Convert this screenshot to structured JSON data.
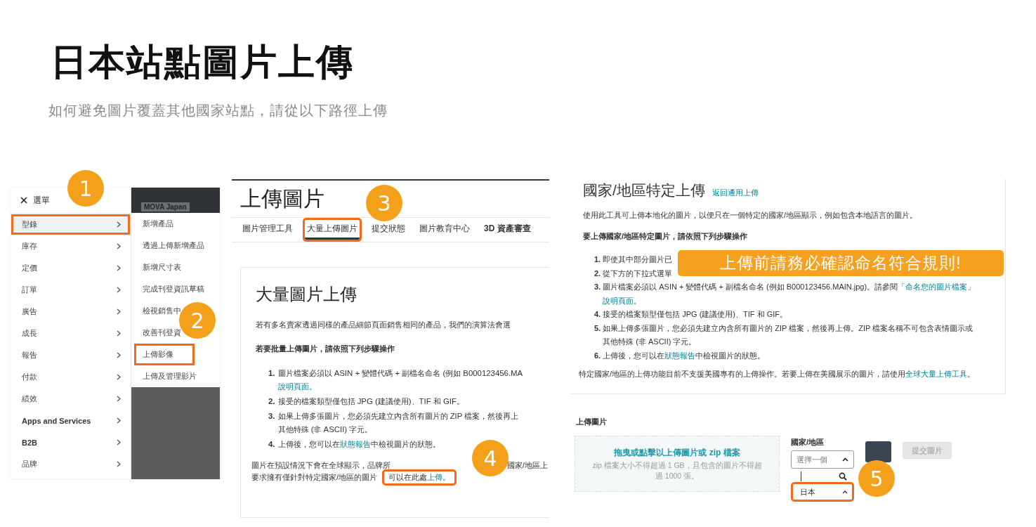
{
  "slide": {
    "title": "日本站點圖片上傳",
    "subtitle": "如何避免圖片覆蓋其他國家站點，請從以下路徑上傳"
  },
  "menu_panel": {
    "header": "選單",
    "backdrop_text": "MOVA Japan",
    "items": [
      {
        "label": "型錄",
        "selected": true,
        "highlighted": true
      },
      {
        "label": "庫存",
        "selected": false,
        "highlighted": false
      },
      {
        "label": "定價",
        "selected": false,
        "highlighted": false
      },
      {
        "label": "訂單",
        "selected": false,
        "highlighted": false
      },
      {
        "label": "廣告",
        "selected": false,
        "highlighted": false
      },
      {
        "label": "成長",
        "selected": false,
        "highlighted": false
      },
      {
        "label": "報告",
        "selected": false,
        "highlighted": false
      },
      {
        "label": "付款",
        "selected": false,
        "highlighted": false
      },
      {
        "label": "績效",
        "selected": false,
        "highlighted": false
      },
      {
        "label": "Apps and Services",
        "selected": false,
        "highlighted": false
      },
      {
        "label": "B2B",
        "selected": false,
        "highlighted": false
      },
      {
        "label": "品牌",
        "selected": false,
        "highlighted": false
      }
    ],
    "submenu": [
      {
        "label": "新增產品",
        "highlighted": false
      },
      {
        "label": "透過上傳新增產品",
        "highlighted": false
      },
      {
        "label": "新增尺寸表",
        "highlighted": false
      },
      {
        "label": "完成刊登資訊草稿",
        "highlighted": false
      },
      {
        "label": "檢視銷售中",
        "highlighted": false
      },
      {
        "label": "改善刊登資",
        "highlighted": false
      },
      {
        "label": "上傳影像",
        "highlighted": true
      },
      {
        "label": "上傳及管理影片",
        "highlighted": false
      }
    ]
  },
  "bulk_panel": {
    "title": "上傳圖片",
    "tabs": [
      {
        "label": "圖片管理工具",
        "selected": false,
        "highlighted": false
      },
      {
        "label": "大量上傳圖片",
        "selected": true,
        "highlighted": true
      },
      {
        "label": "提交狀態",
        "selected": false,
        "highlighted": false
      },
      {
        "label": "圖片教育中心",
        "selected": false,
        "highlighted": false
      },
      {
        "label": "3D 資產審查",
        "selected": false,
        "highlighted": false
      }
    ],
    "card_title": "大量圖片上傳",
    "intro": "若有多名賣家透過同樣的產品細節頁面銷售相同的產品，我們的演算法會選",
    "steps_heading": "若要批量上傳圖片，請依照下列步驟操作",
    "steps": [
      {
        "number": "1.",
        "lines": [
          [
            {
              "kind": "text",
              "text": "圖片檔案必須以 ASIN + 變體代碼 + 副檔名命名 (例如 B000123456.MA"
            }
          ],
          [
            {
              "kind": "link",
              "text": "說明頁面。"
            }
          ]
        ]
      },
      {
        "number": "2.",
        "lines": [
          [
            {
              "kind": "text",
              "text": "接受的檔案類型僅包括 JPG (建議使用)、TIF 和 GIF。"
            }
          ]
        ]
      },
      {
        "number": "3.",
        "lines": [
          [
            {
              "kind": "text",
              "text": "如果上傳多張圖片，您必須先建立內含所有圖片的 ZIP 檔案，然後再上"
            }
          ],
          [
            {
              "kind": "text",
              "text": "其他特殊 (非 ASCII) 字元。"
            }
          ]
        ]
      },
      {
        "number": "4.",
        "lines": [
          [
            {
              "kind": "text",
              "text": "上傳後，您可以在"
            },
            {
              "kind": "link",
              "text": "狀態報告"
            },
            {
              "kind": "text",
              "text": "中檢視圖片的狀態。"
            }
          ]
        ]
      }
    ],
    "note_line": "圖片在預設情況下會在全球顯示，品牌所",
    "note_tail": "國家/地區上",
    "note_prefix": "要求擁有僅針對特定國家/地區的圖片",
    "note_action": {
      "text": "可以在此處",
      "link": "上傳。",
      "highlighted": true
    }
  },
  "country_panel": {
    "title": "國家/地區特定上傳",
    "back_link": "返回通用上傳",
    "intro": "使用此工具可上傳本地化的圖片，以便只在一個特定的國家/地區顯示，例如包含本地語言的圖片。",
    "steps_heading": "要上傳國家/地區特定圖片，請依照下列步驟操作",
    "steps": [
      {
        "number": "1.",
        "lines": [
          [
            {
              "kind": "text",
              "text": "即使其中部分圖片已"
            }
          ]
        ]
      },
      {
        "number": "2.",
        "lines": [
          [
            {
              "kind": "text",
              "text": "從下方的下拉式選單"
            }
          ]
        ]
      },
      {
        "number": "3.",
        "lines": [
          [
            {
              "kind": "text",
              "text": "圖片檔案必須以 ASIN + 變體代碼 + 副檔名命名 (例如 B000123456.MAIN.jpg)。請參閱"
            },
            {
              "kind": "link",
              "text": "「命名您的圖片檔案」"
            }
          ],
          [
            {
              "kind": "link",
              "text": "說明頁面。"
            }
          ]
        ]
      },
      {
        "number": "4.",
        "lines": [
          [
            {
              "kind": "text",
              "text": "接受的檔案類型僅包括 JPG (建議使用)、TIF 和 GIF。"
            }
          ]
        ]
      },
      {
        "number": "5.",
        "lines": [
          [
            {
              "kind": "text",
              "text": "如果上傳多張圖片，您必須先建立內含所有圖片的 ZIP 檔案，然後再上傳。ZIP 檔案名稱不可包含表情圖示或"
            }
          ],
          [
            {
              "kind": "text",
              "text": "其他特殊 (非 ASCII) 字元。"
            }
          ]
        ]
      },
      {
        "number": "6.",
        "lines": [
          [
            {
              "kind": "text",
              "text": "上傳後，您可以在"
            },
            {
              "kind": "link",
              "text": "狀態報告"
            },
            {
              "kind": "text",
              "text": "中檢視圖片的狀態。"
            }
          ]
        ]
      }
    ],
    "footer": [
      {
        "kind": "text",
        "text": "特定國家/地區的上傳功能目前不支援美國專有的上傳操作。若要上傳在美國展示的圖片，請使用"
      },
      {
        "kind": "link",
        "text": "全球大量上傳工具"
      },
      {
        "kind": "text",
        "text": "。"
      }
    ],
    "banner": "上傳前請務必確認命名符合規則!",
    "upload_label": "上傳圖片",
    "dropzone": {
      "title": "拖曳或點擊以上傳圖片或 zip 檔案",
      "hint": "zip 檔案大小不得超過 1 GB，且包含的圖片不得超過 1000 張。"
    },
    "country_label": "國家/地區",
    "select": {
      "value": "選擇一個",
      "expanded": true
    },
    "options": [
      {
        "label": "日本",
        "highlighted": true
      }
    ],
    "submit": {
      "label": "提交圖片",
      "disabled": true
    }
  },
  "badges": [
    "1",
    "2",
    "3",
    "4",
    "5"
  ]
}
